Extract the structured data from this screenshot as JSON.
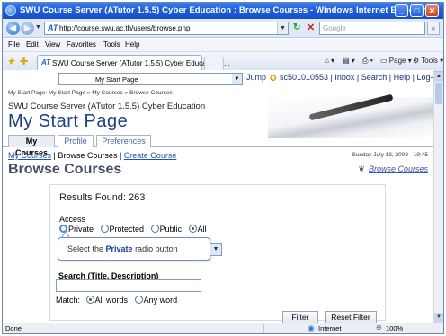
{
  "window": {
    "title": "SWU Course Server (ATutor 1.5.5) Cyber Education : Browse Courses - Windows Internet Explorer",
    "min": "_",
    "max": "□",
    "close": "✕"
  },
  "address": {
    "url": "http://course.swu.ac.th/users/browse.php",
    "search_placeholder": "Google"
  },
  "menu": [
    "File",
    "Edit",
    "View",
    "Favorites",
    "Tools",
    "Help"
  ],
  "tab": {
    "label": "SWU Course Server (ATutor 1.5.5) Cyber Education : ..."
  },
  "commands": {
    "page": "Page",
    "tools": "Tools"
  },
  "jump": {
    "selected": "My Start Page",
    "button": "Jump",
    "user_links": "sc501010553 | Inbox | Search | Help | Log-out"
  },
  "breadcrumb": "My Start Page: My Start Page » My Courses » Browse Courses",
  "site_title": "SWU Course Server (ATutor 1.5.5) Cyber Education",
  "start_page": "My Start Page",
  "course_tabs": [
    "My Courses",
    "Profile",
    "Preferences"
  ],
  "subnav": {
    "my_courses": "My Courses",
    "sep1": "|",
    "browse": "Browse Courses",
    "sep2": "|",
    "create": "Create Course"
  },
  "date": "Sunday July 13, 2008 - 19:45",
  "heading": "Browse Courses",
  "browse_link": "Browse Courses",
  "results": "Results Found: 263",
  "access": {
    "label": "Access",
    "options": [
      "Private",
      "Protected",
      "Public",
      "All"
    ],
    "selected": "All"
  },
  "callout": {
    "prefix": "Select the ",
    "bold": "Private",
    "suffix": " radio button"
  },
  "search": {
    "label": "Search (Title, Description)",
    "value": ""
  },
  "match": {
    "label": "Match:",
    "options": [
      "All words",
      "Any word"
    ],
    "selected": "All words"
  },
  "buttons": {
    "filter": "Filter",
    "reset": "Reset Filter"
  },
  "status": {
    "done": "Done",
    "zone": "Internet",
    "zoom": "100%"
  }
}
